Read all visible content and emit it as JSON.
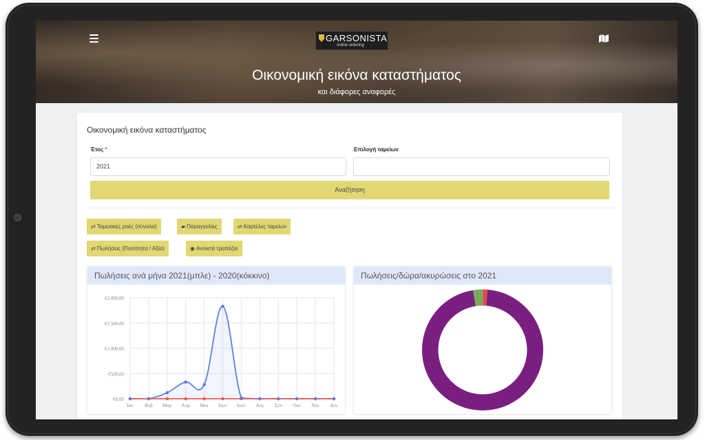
{
  "header": {
    "logo_name": "GARSONISTA",
    "logo_tagline": "online ordering",
    "title": "Οικονομική εικόνα καταστήματος",
    "subtitle": "και διάφορες αναφορές"
  },
  "form": {
    "card_title": "Οικονομική εικόνα καταστήματος",
    "year_label": "Έτος",
    "year_value": "2021",
    "registers_label": "Επιλογή ταμείων",
    "registers_value": "",
    "search_button": "Αναζήτηση"
  },
  "tabs": [
    {
      "label": "Ταμειακές ροές (σύνολα)",
      "icon": "exchange-icon"
    },
    {
      "label": "Παραγγελίες",
      "icon": "wallet-icon"
    },
    {
      "label": "Καρτέλες ταμείων",
      "icon": "exchange-icon"
    },
    {
      "label": "Πωλήσεις (Ποσότητα / Αξία)",
      "icon": "exchange-icon"
    },
    {
      "label": "Ανοικτά τραπέζια",
      "icon": "map-marker-icon"
    }
  ],
  "colors": {
    "accent_yellow": "#e1d773",
    "panel_header": "#dfe7fb",
    "series_2021": "#5b7fe0",
    "series_2020": "#ec5a5a",
    "donut_sales": "#7a1f80",
    "donut_gifts": "#7aa85c",
    "donut_cancellations": "#e04a4a"
  },
  "chart_data": [
    {
      "type": "line",
      "title": "Πωλήσεις ανά μήνα 2021(μπλε) - 2020(κόκκινο)",
      "categories": [
        "Ιαν",
        "Φεβ",
        "Μαρ",
        "Απρ",
        "Μαι",
        "Ιουν",
        "Ιουλ",
        "Αυγ",
        "Σεπ",
        "Οκτ",
        "Νοε",
        "Δεκ"
      ],
      "y_ticks": [
        "€2.000,00",
        "€1.500,00",
        "€1.000,00",
        "€500,00",
        "€0,00"
      ],
      "ylim": [
        0,
        2000
      ],
      "grid": true,
      "series": [
        {
          "values": [
            0,
            0,
            120,
            330,
            280,
            1830,
            20,
            0,
            0,
            0,
            0,
            0
          ],
          "color": "#5b7fe0"
        },
        {
          "values": [
            0,
            0,
            0,
            0,
            0,
            0,
            0,
            0,
            0,
            0,
            0,
            0
          ],
          "color": "#ec5a5a"
        }
      ]
    },
    {
      "type": "pie",
      "title": "Πωλήσεις/δώρα/ακυρώσεις στο 2021",
      "slices": [
        {
          "value": 96.2,
          "color": "#7a1f80"
        },
        {
          "value": 2.6,
          "color": "#7aa85c"
        },
        {
          "value": 1.2,
          "color": "#e04a4a"
        }
      ]
    }
  ]
}
